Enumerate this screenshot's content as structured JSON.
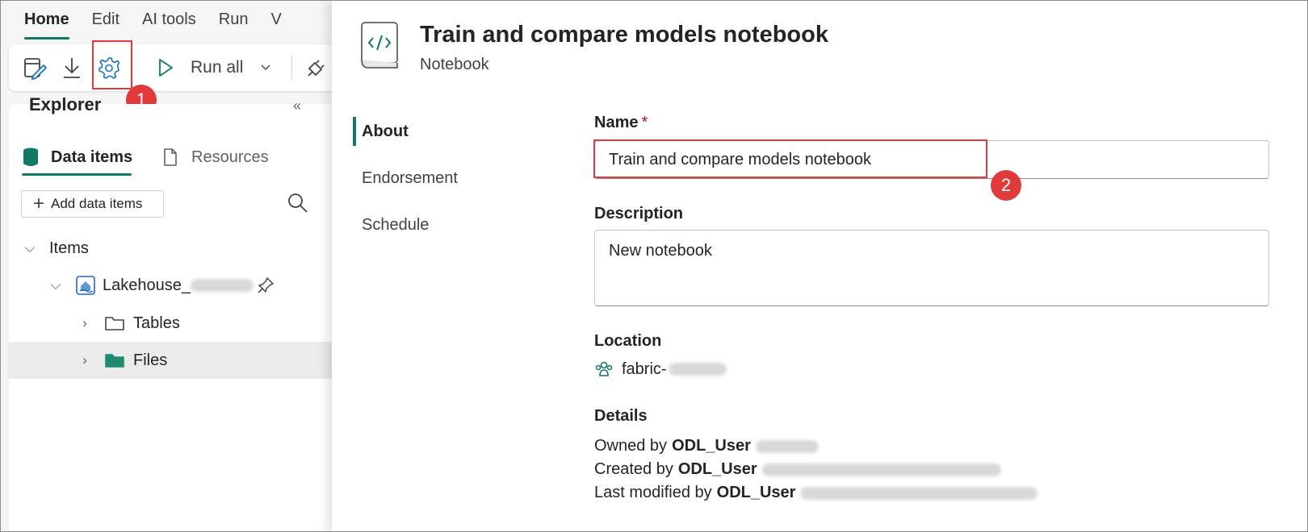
{
  "ribbon": {
    "tabs": [
      {
        "label": "Home",
        "active": true
      },
      {
        "label": "Edit"
      },
      {
        "label": "AI tools"
      },
      {
        "label": "Run"
      },
      {
        "label": "V"
      }
    ],
    "run_all_label": "Run all",
    "accent_color": "#117865",
    "annotation_color": "#e03a3a"
  },
  "annotations": {
    "step1": "1",
    "step2": "2"
  },
  "explorer": {
    "title": "Explorer",
    "collapse_glyph": "«",
    "tabs": {
      "data_items": "Data items",
      "resources": "Resources"
    },
    "add_button": "Add data items",
    "tree": {
      "items_label": "Items",
      "lakehouse_label": "Lakehouse_",
      "tables_label": "Tables",
      "files_label": "Files"
    }
  },
  "dialog": {
    "title": "Train and compare models notebook",
    "subtitle": "Notebook",
    "nav": [
      "About",
      "Endorsement",
      "Schedule"
    ],
    "name_label": "Name",
    "required_mark": "*",
    "name_value": "Train and compare models notebook",
    "description_label": "Description",
    "description_value": "New notebook",
    "location_label": "Location",
    "location_value": "fabric-",
    "details_label": "Details",
    "owned_prefix": "Owned by",
    "created_prefix": "Created by",
    "modified_prefix": "Last modified by",
    "user": "ODL_User"
  }
}
